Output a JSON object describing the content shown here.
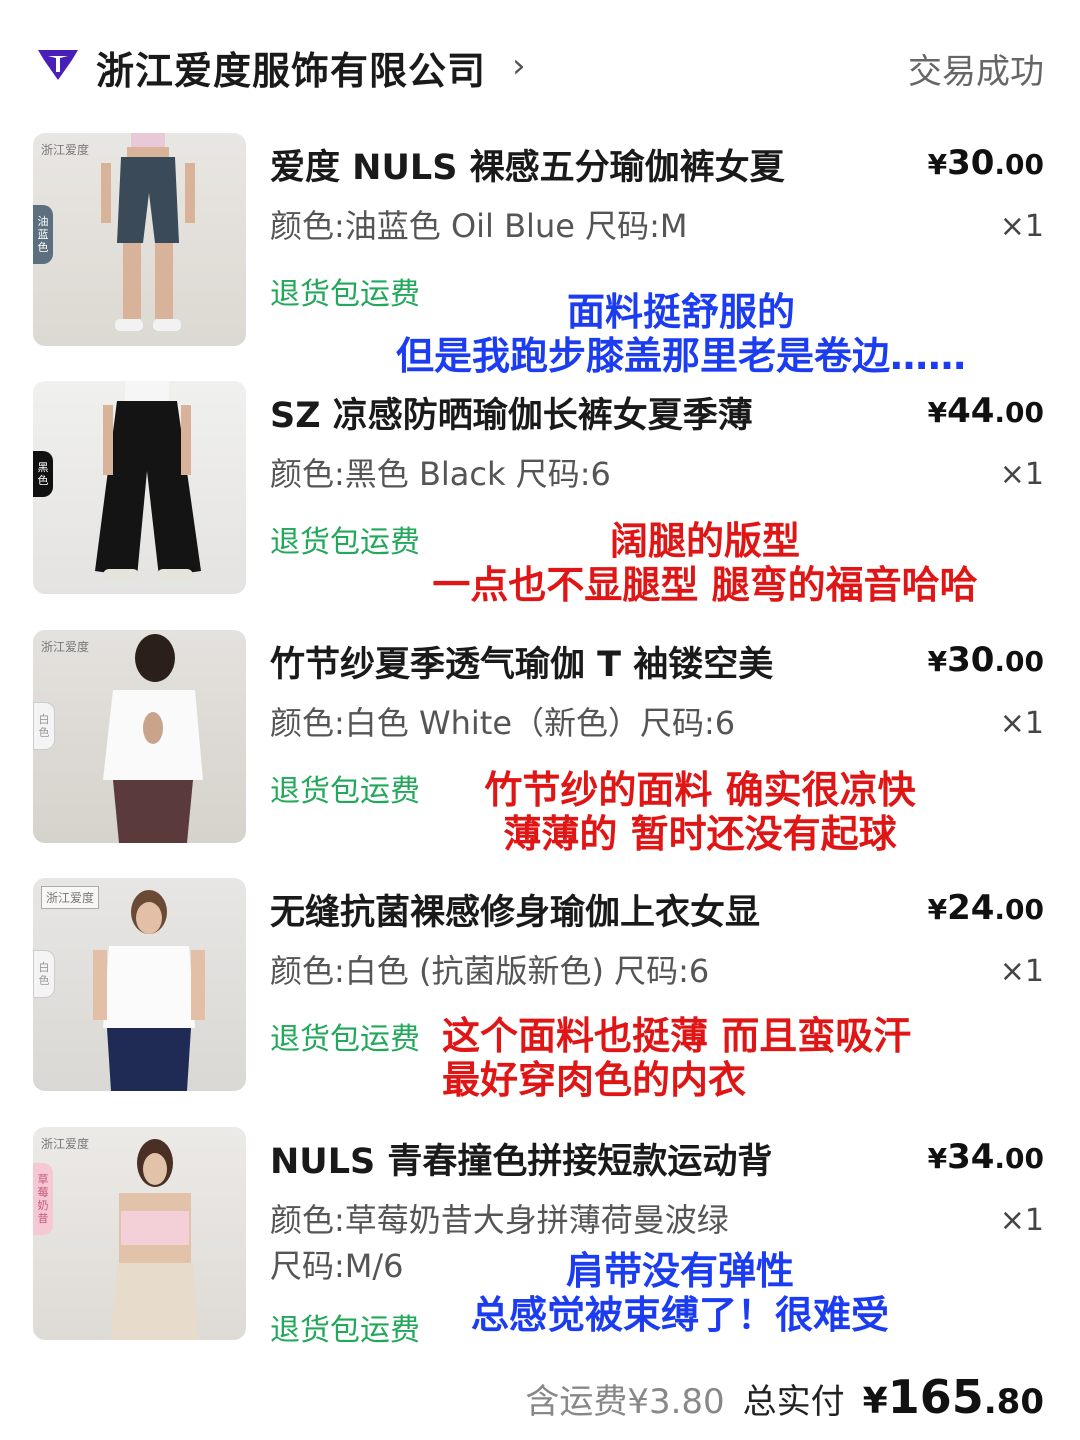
{
  "shop": {
    "name": "浙江爱度服饰有限公司",
    "chevron": "›",
    "status": "交易成功"
  },
  "items": [
    {
      "title": "爱度 NULS 裸感五分瑜伽裤女夏",
      "price_int": "30",
      "price_dec": ".00",
      "spec": "颜色:油蓝色 Oil Blue 尺码:M",
      "qty": "×1",
      "ship_tag": "退货包运费",
      "thumb_brand": "浙江爱度",
      "color_tag": "油蓝色",
      "note_lines": [
        "面料挺舒服的",
        "但是我跑步膝盖那里老是卷边……"
      ],
      "note_color": "blue"
    },
    {
      "title": "SZ 凉感防晒瑜伽长裤女夏季薄",
      "price_int": "44",
      "price_dec": ".00",
      "spec": "颜色:黑色 Black 尺码:6",
      "qty": "×1",
      "ship_tag": "退货包运费",
      "thumb_brand": "",
      "color_tag": "黑色",
      "note_lines": [
        "阔腿的版型",
        "一点也不显腿型 腿弯的福音哈哈"
      ],
      "note_color": "red"
    },
    {
      "title": "竹节纱夏季透气瑜伽 T 袖镂空美",
      "price_int": "30",
      "price_dec": ".00",
      "spec": "颜色:白色 White（新色）尺码:6",
      "qty": "×1",
      "ship_tag": "退货包运费",
      "thumb_brand": "浙江爱度",
      "color_tag": "白色",
      "note_lines": [
        "竹节纱的面料 确实很凉快",
        "薄薄的 暂时还没有起球"
      ],
      "note_color": "red"
    },
    {
      "title": "无缝抗菌裸感修身瑜伽上衣女显",
      "price_int": "24",
      "price_dec": ".00",
      "spec": "颜色:白色 (抗菌版新色) 尺码:6",
      "qty": "×1",
      "ship_tag": "退货包运费",
      "thumb_brand": "浙江爱度",
      "color_tag": "白色",
      "note_lines": [
        "这个面料也挺薄 而且蛮吸汗",
        "最好穿肉色的内衣"
      ],
      "note_color": "red"
    },
    {
      "title": "NULS 青春撞色拼接短款运动背",
      "price_int": "34",
      "price_dec": ".00",
      "spec": "颜色:草莓奶昔大身拼薄荷曼波绿",
      "spec2": "尺码:M/6",
      "qty": "×1",
      "ship_tag": "退货包运费",
      "thumb_brand": "浙江爱度",
      "color_tag": "草莓奶昔",
      "note_lines": [
        "肩带没有弹性",
        "总感觉被束缚了！很难受"
      ],
      "note_color": "blue"
    }
  ],
  "summary": {
    "shipping_fee": "含运费¥3.80",
    "total_label": "总实付",
    "currency": "¥",
    "total_int": "165",
    "total_dec": ".80"
  },
  "colors": {
    "accent_green": "#22a85a",
    "note_blue": "#1b3cf0",
    "note_red": "#e01616",
    "logo_purple": "#4a1fb8"
  },
  "icons": {
    "shop_logo": "shop-logo-icon"
  }
}
